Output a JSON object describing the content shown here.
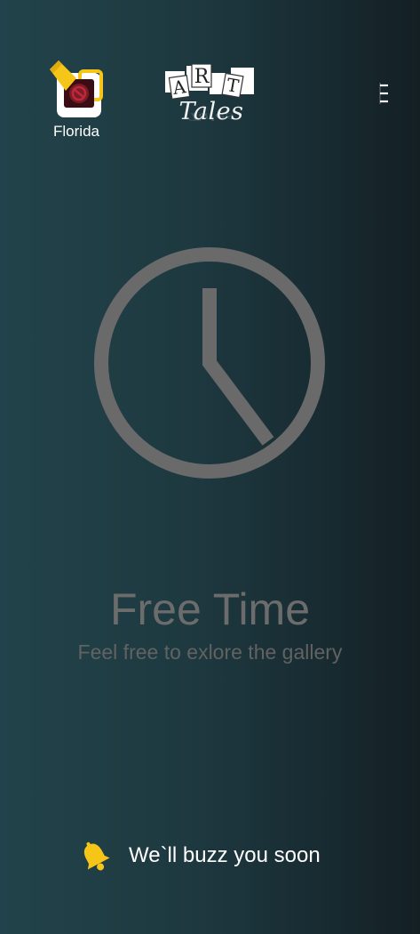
{
  "header": {
    "location": {
      "label": "Florida",
      "icon": "location-pin-icon"
    },
    "logo": {
      "letters": [
        "A",
        "R",
        "T"
      ],
      "tales": "Tales",
      "icon": "art-tales-logo"
    },
    "menu": {
      "icon": "kebab-menu-icon"
    }
  },
  "empty_state": {
    "icon": "clock-icon",
    "title": "Free Time",
    "subtitle": "Feel free to exlore the gallery"
  },
  "footer": {
    "icon": "bell-icon",
    "message": "We`ll buzz you soon"
  },
  "colors": {
    "accent": "#f5c518",
    "muted_text": "#6c6c6c",
    "clock_stroke": "#6a6a6a",
    "background_left": "#22434b",
    "background_right": "#141f23"
  }
}
